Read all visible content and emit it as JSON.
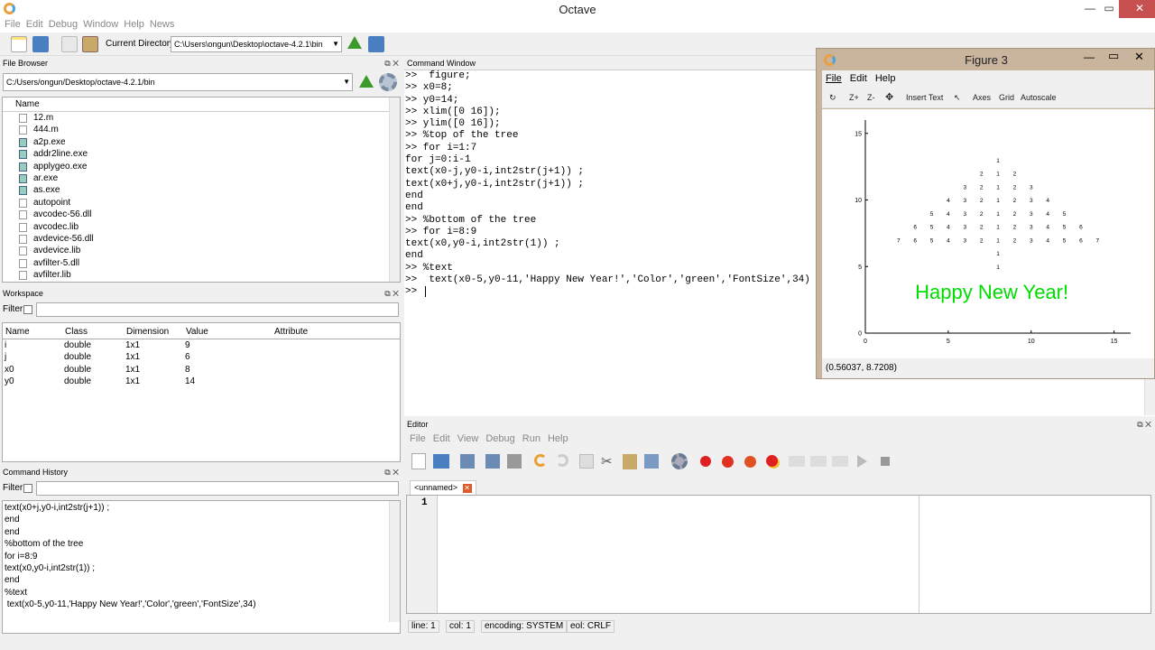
{
  "app": {
    "title": "Octave",
    "menu": [
      "File",
      "Edit",
      "Debug",
      "Window",
      "Help",
      "News"
    ]
  },
  "toolbar": {
    "current_dir_label": "Current Directory:",
    "current_dir": "C:\\Users\\ongun\\Desktop\\octave-4.2.1\\bin"
  },
  "file_browser": {
    "title": "File Browser",
    "path": "C:/Users/ongun/Desktop/octave-4.2.1/bin",
    "col_name": "Name",
    "files": [
      {
        "name": "12.m",
        "type": "m"
      },
      {
        "name": "444.m",
        "type": "m"
      },
      {
        "name": "a2p.exe",
        "type": "exe"
      },
      {
        "name": "addr2line.exe",
        "type": "exe"
      },
      {
        "name": "applygeo.exe",
        "type": "exe"
      },
      {
        "name": "ar.exe",
        "type": "exe"
      },
      {
        "name": "as.exe",
        "type": "exe"
      },
      {
        "name": "autopoint",
        "type": "file"
      },
      {
        "name": "avcodec-56.dll",
        "type": "dll"
      },
      {
        "name": "avcodec.lib",
        "type": "file"
      },
      {
        "name": "avdevice-56.dll",
        "type": "dll"
      },
      {
        "name": "avdevice.lib",
        "type": "file"
      },
      {
        "name": "avfilter-5.dll",
        "type": "dll"
      },
      {
        "name": "avfilter.lib",
        "type": "file"
      }
    ]
  },
  "workspace": {
    "title": "Workspace",
    "filter_label": "Filter",
    "columns": [
      "Name",
      "Class",
      "Dimension",
      "Value",
      "Attribute"
    ],
    "rows": [
      {
        "name": "i",
        "class": "double",
        "dim": "1x1",
        "value": "9"
      },
      {
        "name": "j",
        "class": "double",
        "dim": "1x1",
        "value": "6"
      },
      {
        "name": "x0",
        "class": "double",
        "dim": "1x1",
        "value": "8"
      },
      {
        "name": "y0",
        "class": "double",
        "dim": "1x1",
        "value": "14"
      }
    ]
  },
  "history": {
    "title": "Command History",
    "filter_label": "Filter",
    "lines": [
      "text(x0+j,y0-i,int2str(j+1)) ;",
      "end",
      "end",
      "%bottom of the tree",
      "for i=8:9",
      "text(x0,y0-i,int2str(1)) ;",
      "end",
      "%text",
      " text(x0-5,y0-11,'Happy New Year!','Color','green','FontSize',34)"
    ]
  },
  "command_window": {
    "title": "Command Window",
    "lines": [
      ">>  figure;",
      ">> x0=8;",
      ">> y0=14;",
      ">> xlim([0 16]);",
      ">> ylim([0 16]);",
      ">> %top of the tree",
      ">> for i=1:7",
      "for j=0:i-1",
      "text(x0-j,y0-i,int2str(j+1)) ;",
      "text(x0+j,y0-i,int2str(j+1)) ;",
      "end",
      "end",
      ">> %bottom of the tree",
      ">> for i=8:9",
      "text(x0,y0-i,int2str(1)) ;",
      "end",
      ">> %text",
      ">>  text(x0-5,y0-11,'Happy New Year!','Color','green','FontSize',34)",
      ">> "
    ]
  },
  "figure": {
    "title": "Figure 3",
    "menu": [
      "File",
      "Edit",
      "Help"
    ],
    "tools": [
      "Z+",
      "Z-",
      "Insert Text",
      "Axes",
      "Grid",
      "Autoscale"
    ],
    "coords": "(0.56037, 8.7208)",
    "message": "Happy New Year!",
    "message_color": "#00dd00",
    "message_x": 3,
    "message_y": 3
  },
  "chart_data": {
    "type": "scatter",
    "xlim": [
      0,
      16
    ],
    "ylim": [
      0,
      16
    ],
    "xticks": [
      "0",
      "5",
      "10",
      "15"
    ],
    "yticks": [
      "0",
      "5",
      "10",
      "15"
    ],
    "x0": 8,
    "y0": 14,
    "tree_rows": 7,
    "trunk_rows": [
      8,
      9
    ]
  },
  "editor": {
    "title": "Editor",
    "menu": [
      "File",
      "Edit",
      "View",
      "Debug",
      "Run",
      "Help"
    ],
    "tab": "<unnamed>",
    "line_number": "1",
    "status": {
      "line": "line: 1",
      "col": "col: 1",
      "encoding": "encoding: SYSTEM",
      "eol": "eol: CRLF"
    }
  }
}
